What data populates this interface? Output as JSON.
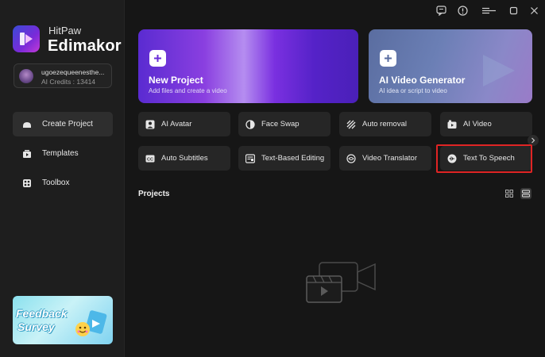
{
  "app": {
    "brand_small": "HitPaw",
    "brand_big": "Edimakor"
  },
  "user": {
    "name": "ugoezequeenesthe...",
    "credits": "AI Credits : 13414"
  },
  "nav": {
    "items": [
      {
        "label": "Create Project",
        "icon": "create-project-icon",
        "active": true
      },
      {
        "label": "Templates",
        "icon": "templates-icon",
        "active": false
      },
      {
        "label": "Toolbox",
        "icon": "toolbox-icon",
        "active": false
      }
    ]
  },
  "banner": {
    "line1": "Feedback",
    "line2": "Survey"
  },
  "cards": {
    "new_project": {
      "title": "New Project",
      "subtitle": "Add files and create a video"
    },
    "ai_video": {
      "title": "AI Video Generator",
      "subtitle": "AI idea or script to video"
    }
  },
  "tools": [
    {
      "label": "AI Avatar",
      "icon": "ai-avatar-icon"
    },
    {
      "label": "Face Swap",
      "icon": "face-swap-icon"
    },
    {
      "label": "Auto removal",
      "icon": "auto-removal-icon"
    },
    {
      "label": "AI Video",
      "icon": "ai-video-icon"
    },
    {
      "label": "Auto Subtitles",
      "icon": "auto-subtitles-icon"
    },
    {
      "label": "Text-Based Editing",
      "icon": "text-based-editing-icon"
    },
    {
      "label": "Video Translator",
      "icon": "video-translator-icon"
    },
    {
      "label": "Text To Speech",
      "icon": "text-to-speech-icon"
    }
  ],
  "projects": {
    "title": "Projects"
  },
  "colors": {
    "accent_highlight": "#e02424",
    "background": "#161616",
    "sidebar": "#1e1e1e",
    "tool_bg": "#262626"
  }
}
